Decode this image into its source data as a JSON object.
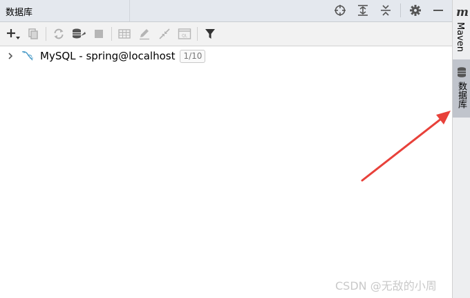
{
  "panel": {
    "title": "数据库"
  },
  "title_icons": [
    "crosshair-icon",
    "expand-all-icon",
    "collapse-all-icon",
    "gear-icon",
    "minimize-icon"
  ],
  "toolbar": [
    "add-icon",
    "duplicate-icon",
    "refresh-icon",
    "schema-icon",
    "stop-icon",
    "table-icon",
    "edit-icon",
    "jump-icon",
    "sql-console-icon",
    "filter-icon"
  ],
  "tree": {
    "items": [
      {
        "label": "MySQL - spring@localhost",
        "badge": "1/10",
        "expanded": false
      }
    ]
  },
  "right_sidebar": {
    "tabs": [
      {
        "label": "Maven",
        "icon": "maven-icon",
        "icon_text": "m",
        "active": false
      },
      {
        "label": "数据库",
        "icon": "database-icon",
        "active": true
      }
    ]
  },
  "watermark": "CSDN @无敌的小周",
  "colors": {
    "arrow": "#e8413a",
    "active_tab": "#c0c4cc"
  }
}
